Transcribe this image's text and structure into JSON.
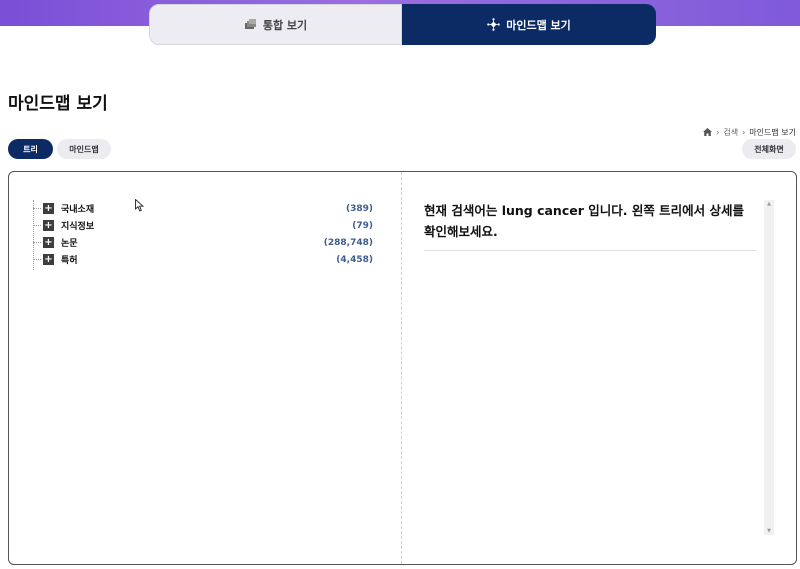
{
  "tabs": {
    "integrated": {
      "label": "통합 보기",
      "icon": "stack-icon"
    },
    "mindmap": {
      "label": "마인드맵 보기",
      "icon": "network-icon"
    }
  },
  "page": {
    "title": "마인드맵 보기"
  },
  "breadcrumb": {
    "home_icon": "home-icon",
    "items": [
      "검색",
      "마인드맵 보기"
    ]
  },
  "view_buttons": {
    "tree": "트리",
    "mindmap": "마인드맵"
  },
  "fullscreen_label": "전체화면",
  "tree": {
    "nodes": [
      {
        "label": "국내소재",
        "count": "(389)"
      },
      {
        "label": "지식정보",
        "count": "(79)"
      },
      {
        "label": "논문",
        "count": "(288,748)"
      },
      {
        "label": "특허",
        "count": "(4,458)"
      }
    ]
  },
  "detail": {
    "message": "현재 검색어는 lung cancer 입니다. 왼쪽 트리에서 상세를 확인해보세요."
  },
  "colors": {
    "accent": "#0c2a63",
    "topbar": "#8a5fdc",
    "count": "#3f5d8c"
  }
}
